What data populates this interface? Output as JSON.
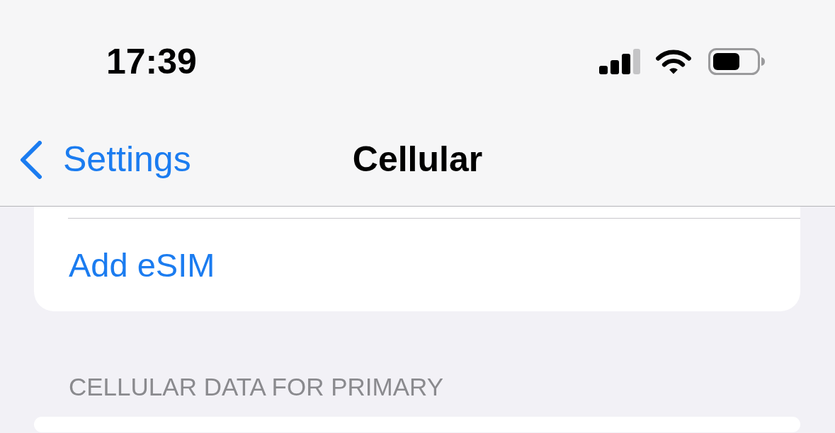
{
  "status_bar": {
    "time": "17:39"
  },
  "nav_bar": {
    "back_label": "Settings",
    "title": "Cellular"
  },
  "groups": [
    {
      "rows": [
        {
          "label": "Add eSIM"
        }
      ]
    },
    {
      "header": "CELLULAR DATA FOR PRIMARY"
    }
  ]
}
